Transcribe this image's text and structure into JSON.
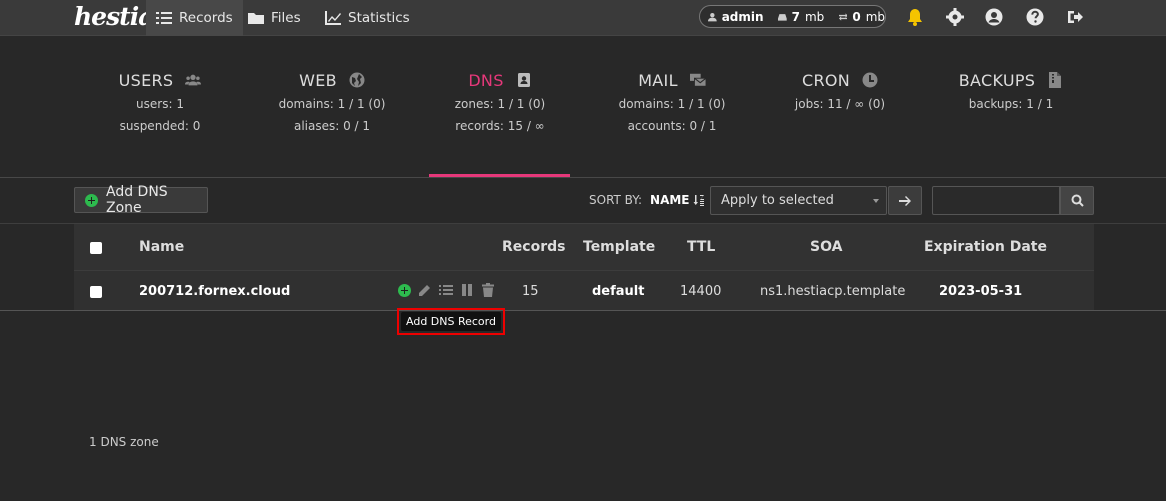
{
  "brand": {
    "logo": "hestia"
  },
  "nav": {
    "records": "Records",
    "files": "Files",
    "statistics": "Statistics"
  },
  "user": {
    "name": "admin",
    "disk_value": "7",
    "disk_unit": "mb",
    "bandwidth_value": "0",
    "bandwidth_unit": "mb"
  },
  "stats": {
    "users": {
      "title": "USERS",
      "line1": "users: 1",
      "line2": "suspended: 0"
    },
    "web": {
      "title": "WEB",
      "line1": "domains: 1 / 1 (0)",
      "line2": "aliases: 0 / 1"
    },
    "dns": {
      "title": "DNS",
      "line1": "zones: 1 / 1 (0)",
      "line2": "records: 15 / ∞"
    },
    "mail": {
      "title": "MAIL",
      "line1": "domains: 1 / 1 (0)",
      "line2": "accounts: 0 / 1"
    },
    "cron": {
      "title": "CRON",
      "line1": "jobs: 11 / ∞ (0)"
    },
    "backups": {
      "title": "BACKUPS",
      "line1": "backups: 1 / 1"
    }
  },
  "toolbar": {
    "add_label": "Add DNS Zone",
    "sort_by_label": "SORT BY:",
    "sort_field": "NAME",
    "bulk_action": "Apply to selected",
    "search_value": ""
  },
  "table": {
    "headers": {
      "name": "Name",
      "records": "Records",
      "template": "Template",
      "ttl": "TTL",
      "soa": "SOA",
      "expiration": "Expiration Date"
    },
    "rows": [
      {
        "name": "200712.fornex.cloud",
        "records": "15",
        "template": "default",
        "ttl": "14400",
        "soa": "ns1.hestiacp.template",
        "expiration": "2023-05-31"
      }
    ]
  },
  "tooltip": "Add DNS Record",
  "footer": {
    "count": "1 DNS zone"
  },
  "colors": {
    "accent": "#e6387a",
    "add_green": "#2dba4e",
    "bell": "#f5c400"
  }
}
